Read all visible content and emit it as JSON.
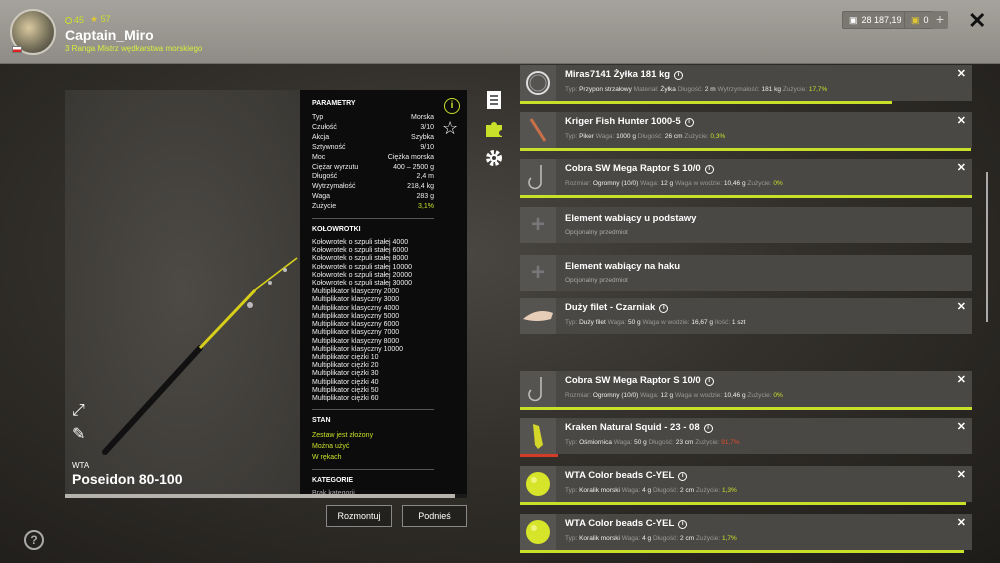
{
  "header": {
    "level": "45",
    "stars": "57",
    "player_name": "Captain_Miro",
    "rank": "3 Ranga Mistrz wędkarstwa morskiego",
    "money": "28 187,19",
    "coins": "0",
    "plus": "+",
    "close": "✕"
  },
  "rod": {
    "brand": "WTA",
    "name": "Poseidon 80-100"
  },
  "params": {
    "title": "PARAMETRY",
    "rows": [
      {
        "k": "Typ",
        "v": "Morska"
      },
      {
        "k": "Czułość",
        "v": "3/10"
      },
      {
        "k": "Akcja",
        "v": "Szybka"
      },
      {
        "k": "Sztywność",
        "v": "9/10"
      },
      {
        "k": "Moc",
        "v": "Ciężka morska"
      },
      {
        "k": "Ciężar wyrzutu",
        "v": "400 – 2500 g"
      },
      {
        "k": "Długość",
        "v": "2,4 m"
      },
      {
        "k": "Wytrzymałość",
        "v": "218,4 kg"
      },
      {
        "k": "Waga",
        "v": "283 g"
      },
      {
        "k": "Zużycie",
        "v": "3,1%"
      }
    ],
    "reels_title": "KOŁOWROTKI",
    "reels": [
      "Kołowrotek o szpuli stałej 4000",
      "Kołowrotek o szpuli stałej 6000",
      "Kołowrotek o szpuli stałej 8000",
      "Kołowrotek o szpuli stałej 10000",
      "Kołowrotek o szpuli stałej 20000",
      "Kołowrotek o szpuli stałej 30000",
      "Multiplikator klasyczny 2000",
      "Multiplikator klasyczny 3000",
      "Multiplikator klasyczny 4000",
      "Multiplikator klasyczny 5000",
      "Multiplikator klasyczny 6000",
      "Multiplikator klasyczny 7000",
      "Multiplikator klasyczny 8000",
      "Multiplikator klasyczny 10000",
      "Multiplikator ciężki 10",
      "Multiplikator ciężki 20",
      "Multiplikator ciężki 30",
      "Multiplikator ciężki 40",
      "Multiplikator ciężki 50",
      "Multiplikator ciężki 60"
    ],
    "state_title": "STAN",
    "states": [
      "Zestaw jest złożony",
      "Można użyć",
      "W rękach"
    ],
    "category_title": "KATEGORIE",
    "category": "Brak kategorii"
  },
  "buttons": {
    "disassemble": "Rozmontuj",
    "pickup": "Podnieś"
  },
  "items": [
    {
      "title": "Miras7141 Żyłka 181 kg",
      "meta": [
        [
          "Typ:",
          "Przypon strzałowy"
        ],
        [
          "Materiał:",
          "Żyłka"
        ],
        [
          "Długość:",
          "2 m"
        ],
        [
          "Wytrzymałość:",
          "181 kg"
        ],
        [
          "Zużycie:",
          "17,7%"
        ]
      ],
      "wear_color": "g",
      "wear_level": 0.823
    },
    {
      "title": "Kriger Fish Hunter 1000-5",
      "meta": [
        [
          "Typ:",
          "Piker"
        ],
        [
          "Waga:",
          "1000 g"
        ],
        [
          "Długość:",
          "26 cm"
        ],
        [
          "Zużycie:",
          "0,3%"
        ]
      ],
      "wear_color": "g",
      "wear_level": 0.997
    },
    {
      "title": "Cobra SW Mega Raptor S 10/0",
      "meta": [
        [
          "Rozmiar:",
          "Ogromny (10/0)"
        ],
        [
          "Waga:",
          "12 g"
        ],
        [
          "Waga w wodzie:",
          "10,46 g"
        ],
        [
          "Zużycie:",
          "0%"
        ]
      ],
      "wear_color": "g",
      "wear_level": 1.0
    },
    {
      "title": "Element wabiący u podstawy",
      "sub": "Opcjonalny przedmiot"
    },
    {
      "title": "Element wabiący na haku",
      "sub": "Opcjonalny przedmiot"
    },
    {
      "title": "Duży filet - Czarniak",
      "meta": [
        [
          "Typ:",
          "Duży filet"
        ],
        [
          "Waga:",
          "50 g"
        ],
        [
          "Waga w wodzie:",
          "16,67 g"
        ],
        [
          "Ilość:",
          "1 szt"
        ]
      ]
    },
    {
      "title": "Cobra SW Mega Raptor S 10/0",
      "meta": [
        [
          "Rozmiar:",
          "Ogromny (10/0)"
        ],
        [
          "Waga:",
          "12 g"
        ],
        [
          "Waga w wodzie:",
          "10,46 g"
        ],
        [
          "Zużycie:",
          "0%"
        ]
      ],
      "wear_color": "g",
      "wear_level": 1.0
    },
    {
      "title": "Kraken Natural Squid - 23 - 08",
      "meta": [
        [
          "Typ:",
          "Ośmiornica"
        ],
        [
          "Waga:",
          "50 g"
        ],
        [
          "Długość:",
          "23 cm"
        ],
        [
          "Zużycie:",
          "91,7%"
        ]
      ],
      "wear_color": "r",
      "wear_level": 0.083
    },
    {
      "title": "WTA Color beads C-YEL",
      "meta": [
        [
          "Typ:",
          "Koralik morski"
        ],
        [
          "Waga:",
          "4 g"
        ],
        [
          "Długość:",
          "2 cm"
        ],
        [
          "Zużycie:",
          "1,3%"
        ]
      ],
      "wear_color": "g",
      "wear_level": 0.987
    },
    {
      "title": "WTA Color beads C-YEL",
      "meta": [
        [
          "Typ:",
          "Koralik morski"
        ],
        [
          "Waga:",
          "4 g"
        ],
        [
          "Długość:",
          "2 cm"
        ],
        [
          "Zużycie:",
          "1,7%"
        ]
      ],
      "wear_color": "g",
      "wear_level": 0.983
    }
  ],
  "colors": {
    "accent": "#c9e02a",
    "danger": "#d43c2a"
  }
}
